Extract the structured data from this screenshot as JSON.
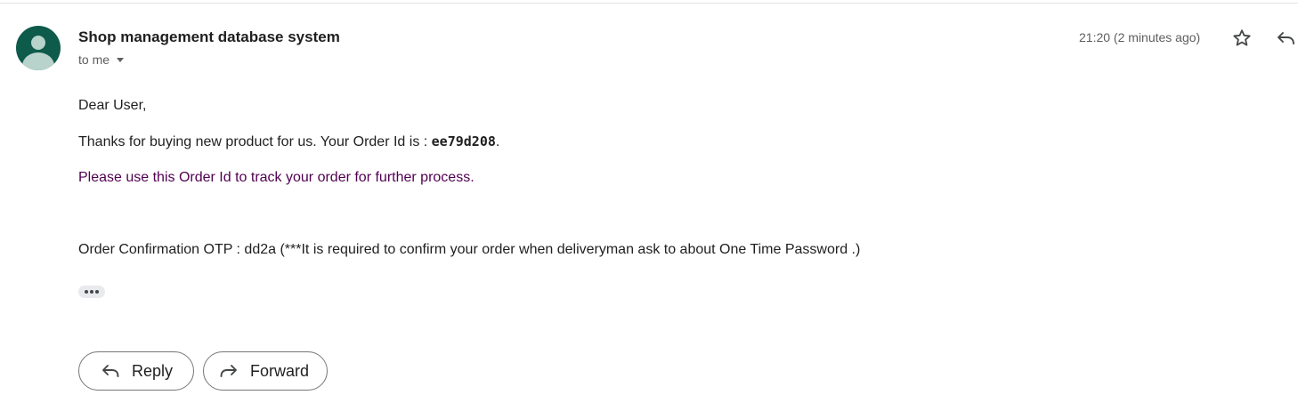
{
  "email": {
    "sender": "Shop management database system",
    "recipient": "to me",
    "timestamp": "21:20 (2 minutes ago)",
    "icons": {
      "avatar": "person-avatar-icon",
      "star": "star-icon",
      "reply": "reply-icon",
      "forward": "forward-icon",
      "recipient_toggle": "caret-down-icon",
      "trimmed_content": "ellipsis-icon"
    },
    "body": {
      "greeting": "Dear User,",
      "order_line_prefix": "Thanks for buying new product for us. Your Order Id is : ",
      "order_id": "ee79d208",
      "order_line_suffix": ".",
      "track_line": "Please use this Order Id to track your order for further process.",
      "otp_line": "Order Confirmation OTP : dd2a (***It is required to confirm your order when deliveryman ask to about One Time Password .)"
    },
    "actions": {
      "reply_label": "Reply",
      "forward_label": "Forward"
    },
    "colors": {
      "avatar_bg": "#0e5a4b",
      "track_text": "#500050"
    }
  }
}
